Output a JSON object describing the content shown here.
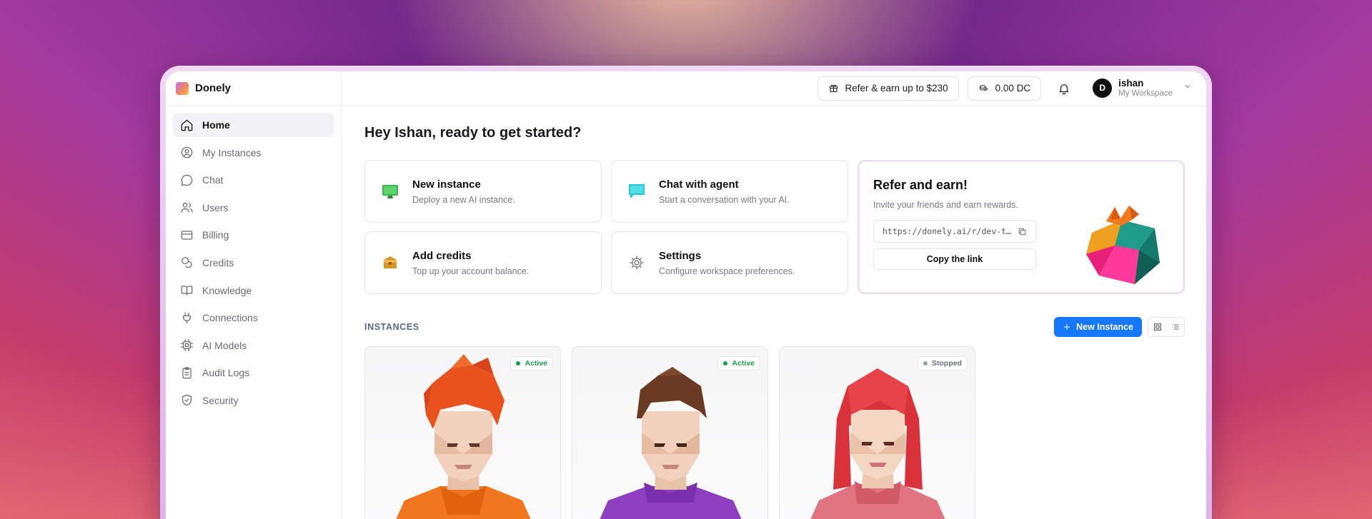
{
  "app": {
    "name": "Donely"
  },
  "sidebar": {
    "items": [
      {
        "label": "Home",
        "icon": "home-icon",
        "active": true
      },
      {
        "label": "My Instances",
        "icon": "user-circle-icon"
      },
      {
        "label": "Chat",
        "icon": "chat-bubble-icon"
      },
      {
        "label": "Users",
        "icon": "users-icon"
      },
      {
        "label": "Billing",
        "icon": "credit-card-icon"
      },
      {
        "label": "Credits",
        "icon": "coins-icon"
      },
      {
        "label": "Knowledge",
        "icon": "book-open-icon"
      },
      {
        "label": "Connections",
        "icon": "plug-icon"
      },
      {
        "label": "AI Models",
        "icon": "cpu-chip-icon"
      },
      {
        "label": "Audit Logs",
        "icon": "clipboard-icon"
      },
      {
        "label": "Security",
        "icon": "shield-check-icon"
      }
    ]
  },
  "topbar": {
    "refer_label": "Refer & earn up to $230",
    "credits_label": "0.00 DC",
    "user": {
      "initial": "D",
      "name": "ishan",
      "workspace": "My Workspace"
    }
  },
  "main": {
    "greeting": "Hey Ishan, ready to get started?",
    "quick_actions": [
      {
        "title": "New instance",
        "subtitle": "Deploy a new AI instance.",
        "icon": "monitor-icon"
      },
      {
        "title": "Chat with agent",
        "subtitle": "Start a conversation with your AI.",
        "icon": "chat-icon"
      },
      {
        "title": "Add credits",
        "subtitle": "Top up your account balance.",
        "icon": "wallet-icon"
      },
      {
        "title": "Settings",
        "subtitle": "Configure workspace preferences.",
        "icon": "gear-icon"
      }
    ],
    "refer": {
      "title": "Refer and earn!",
      "subtitle": "Invite your friends and earn rewards.",
      "link": "https://donely.ai/r/dev-t…",
      "copy_label": "Copy the link"
    },
    "instances": {
      "section_label": "INSTANCES",
      "new_button": "New Instance",
      "cards": [
        {
          "status": "Active",
          "status_color": "#16a34a",
          "hair": "#e8521c",
          "shirt": "#f0761f"
        },
        {
          "status": "Active",
          "status_color": "#16a34a",
          "hair": "#6b3a22",
          "shirt": "#8e3fc0"
        },
        {
          "status": "Stopped",
          "status_color": "#9aa0aa",
          "hair": "#d9323a",
          "shirt": "#e07480"
        }
      ]
    }
  },
  "colors": {
    "accent": "#1677ff",
    "active_status": "#16a34a",
    "stopped_status": "#9aa0aa"
  }
}
